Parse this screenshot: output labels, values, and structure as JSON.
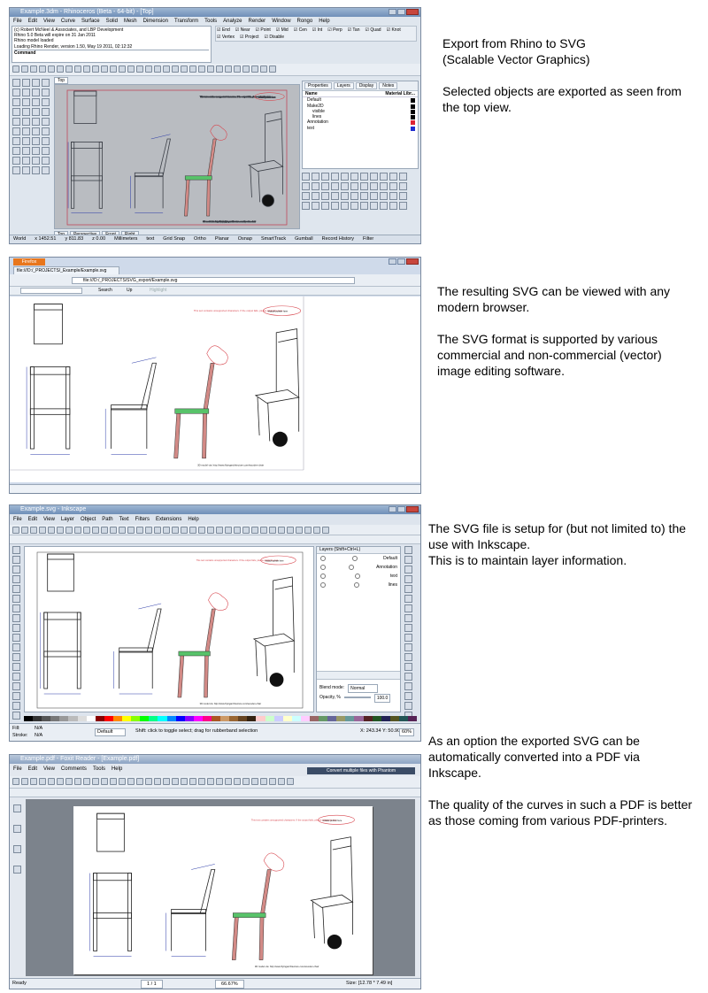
{
  "colors": {
    "titlebar_blue": "#6f8fb8",
    "dimension_blue": "#2a3aa8",
    "annotation_red": "#d8474f",
    "chair_green": "#58c36a",
    "chair_pink": "#d28a86",
    "viewport_border_red": "#c24a5a",
    "firefox_orange": "#e8761c"
  },
  "section1": {
    "description": [
      "Export from Rhino to SVG\n (Scalable Vector Graphics)",
      "Selected objects are exported as seen from the top view."
    ],
    "title": "Example.3dm - Rhinoceros (Beta - 64-bit) - [Top]",
    "menu": [
      "File",
      "Edit",
      "View",
      "Curve",
      "Surface",
      "Solid",
      "Mesh",
      "Dimension",
      "Transform",
      "Tools",
      "Analyze",
      "Render",
      "Window",
      "Rongo",
      "Help"
    ],
    "command_lines": [
      "(c) Robert McNeel & Associates, and LBP Development",
      "Rhino 5.0 Beta will expire on 31 Jan 2011",
      "Rhino model loaded",
      "Loading Rhino Render, version 1.50, May 19 2011, 02:12:32"
    ],
    "command_label": "Command",
    "osnaps": [
      "End",
      "Near",
      "Point",
      "Mid",
      "Cen",
      "Int",
      "Perp",
      "Tan",
      "Quad",
      "Knot",
      "Vertex",
      "Project",
      "Disable"
    ],
    "viewport_label": "Top",
    "view_tabs": [
      "Top",
      "Perspective",
      "Front",
      "Right"
    ],
    "panel_tabs": [
      "Properties",
      "Layers",
      "Display",
      "Notes"
    ],
    "layer_header": [
      "Name",
      "Material Libr..."
    ],
    "layers": [
      "Default",
      "Make2D",
      "visible",
      "lines",
      "Annotation",
      "text"
    ],
    "status": [
      "World",
      "x 1452.51",
      "y 811.83",
      "z 0.00",
      "Millimeters",
      "text",
      "Grid Snap",
      "Ortho",
      "Planar",
      "Osnap",
      "SmartTrack",
      "Gumball",
      "Record History",
      "Filter"
    ]
  },
  "section2": {
    "description": [
      "The resulting SVG can be viewed with any modern browser.",
      "The SVG format is supported by various commercial and non-commercial (vector) image editing software."
    ],
    "app_button": "Firefox",
    "tab_title": "file:///D:/_PROJECTS/_Example/Example.svg",
    "address": "file:///D:/_PROJECTS/SVG_export/Example.svg",
    "toolbar_items": [
      "Search",
      "Up",
      "Highlight"
    ]
  },
  "section3": {
    "description": [
      "The SVG file is setup for (but not limited to) the use with Inkscape.\nThis is to maintain layer information."
    ],
    "title": "Example.svg - Inkscape",
    "menu": [
      "File",
      "Edit",
      "View",
      "Layer",
      "Object",
      "Path",
      "Text",
      "Filters",
      "Extensions",
      "Help"
    ],
    "layers_title": "Layers (Shift+Ctrl+L)",
    "layers": [
      "Default",
      "Annotation",
      "text",
      "lines"
    ],
    "blend_mode_label": "Blend mode:",
    "blend_mode_value": "Normal",
    "opacity_label": "Opacity, %",
    "opacity_value": "100.0",
    "status_text": "Shift: click to toggle select; drag for rubberband selection",
    "layer_select": "Default",
    "fill_label": "Fill:",
    "stroke_label": "Stroke:",
    "fill_value": "N/A",
    "stroke_value": "N/A",
    "coords": "X: 243.34  Y: 50.90",
    "zoom": "60%"
  },
  "section4": {
    "description": [
      "As an option the exported SVG can be automatically converted into a PDF via Inkscape.",
      "The quality of the curves in such a PDF is better as those coming from various PDF-printers."
    ],
    "title": "Example.pdf - Foxit Reader - [Example.pdf]",
    "banner": "Convert multiple files with Phantom",
    "menu": [
      "File",
      "Edit",
      "View",
      "Comments",
      "Tools",
      "Help"
    ],
    "status_left": "Ready",
    "page_indicator": "1 / 1",
    "zoom": "66.67%",
    "size": "Size: [12.78 * 7.49 in]"
  },
  "drawing": {
    "annotation_top": "This text contains unsupported characters. If the output fails, please adapt the text.",
    "annotation_bubble": "Include pointer here",
    "credit": "3D model via: http://www.flyingarchitecture.com/wooden-chair"
  }
}
